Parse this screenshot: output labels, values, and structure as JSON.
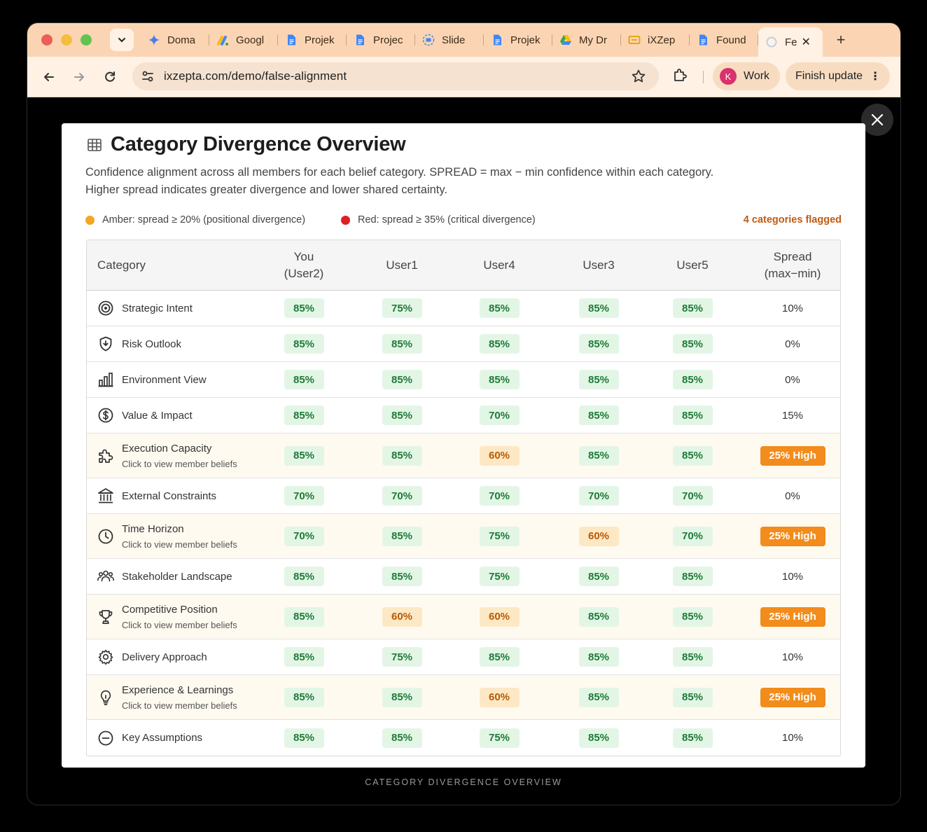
{
  "browser": {
    "tabs": [
      {
        "title": "Doma",
        "icon": "gemini-icon"
      },
      {
        "title": "Googl",
        "icon": "google-ads-icon"
      },
      {
        "title": "Projek",
        "icon": "docs-icon"
      },
      {
        "title": "Projec",
        "icon": "docs-icon"
      },
      {
        "title": "Slide",
        "icon": "slides-icon"
      },
      {
        "title": "Projek",
        "icon": "docs-icon"
      },
      {
        "title": "My Dr",
        "icon": "drive-icon"
      },
      {
        "title": "iXZep",
        "icon": "ixzepta-icon"
      },
      {
        "title": "Found",
        "icon": "docs-icon"
      },
      {
        "title": "Fe",
        "icon": "loading-icon",
        "active": true
      }
    ],
    "url": "ixzepta.com/demo/false-alignment",
    "profile_initial": "K",
    "profile_label": "Work",
    "finish_label": "Finish update"
  },
  "modal": {
    "title": "Category Divergence Overview",
    "description_line1": "Confidence alignment across all members for each belief category. SPREAD = max − min confidence within each category.",
    "description_line2": "Higher spread indicates greater divergence and lower shared certainty.",
    "legend_amber": "Amber: spread ≥ 20% (positional divergence)",
    "legend_red": "Red: spread ≥ 35% (critical divergence)",
    "flagged_count": "4 categories flagged",
    "colors": {
      "amber": "#f5a623",
      "red": "#dd1f26",
      "ok_bg": "#e3f6e6",
      "warn_bg": "#fde8c5",
      "high": "#f28c1c"
    }
  },
  "table": {
    "headers": {
      "category": "Category",
      "you_line1": "You",
      "you_line2": "(User2)",
      "user1": "User1",
      "user4": "User4",
      "user3": "User3",
      "user5": "User5",
      "spread_line1": "Spread",
      "spread_line2": "(max−min)"
    },
    "rows": [
      {
        "name": "Strategic Intent",
        "icon": "target-icon",
        "sub": "",
        "values": [
          "85%",
          "75%",
          "85%",
          "85%",
          "85%"
        ],
        "warn": [
          false,
          false,
          false,
          false,
          false
        ],
        "spread": "10%",
        "high": false
      },
      {
        "name": "Risk Outlook",
        "icon": "shield-icon",
        "sub": "",
        "values": [
          "85%",
          "85%",
          "85%",
          "85%",
          "85%"
        ],
        "warn": [
          false,
          false,
          false,
          false,
          false
        ],
        "spread": "0%",
        "high": false
      },
      {
        "name": "Environment View",
        "icon": "bar-chart-icon",
        "sub": "",
        "values": [
          "85%",
          "85%",
          "85%",
          "85%",
          "85%"
        ],
        "warn": [
          false,
          false,
          false,
          false,
          false
        ],
        "spread": "0%",
        "high": false
      },
      {
        "name": "Value & Impact",
        "icon": "dollar-icon",
        "sub": "",
        "values": [
          "85%",
          "85%",
          "70%",
          "85%",
          "85%"
        ],
        "warn": [
          false,
          false,
          false,
          false,
          false
        ],
        "spread": "15%",
        "high": false
      },
      {
        "name": "Execution Capacity",
        "icon": "puzzle-icon",
        "sub": "Click to view member beliefs",
        "values": [
          "85%",
          "85%",
          "60%",
          "85%",
          "85%"
        ],
        "warn": [
          false,
          false,
          true,
          false,
          false
        ],
        "spread": "25% High",
        "high": true
      },
      {
        "name": "External Constraints",
        "icon": "bank-icon",
        "sub": "",
        "values": [
          "70%",
          "70%",
          "70%",
          "70%",
          "70%"
        ],
        "warn": [
          false,
          false,
          false,
          false,
          false
        ],
        "spread": "0%",
        "high": false
      },
      {
        "name": "Time Horizon",
        "icon": "clock-icon",
        "sub": "Click to view member beliefs",
        "values": [
          "70%",
          "85%",
          "75%",
          "60%",
          "70%"
        ],
        "warn": [
          false,
          false,
          false,
          true,
          false
        ],
        "spread": "25% High",
        "high": true
      },
      {
        "name": "Stakeholder Landscape",
        "icon": "people-icon",
        "sub": "",
        "values": [
          "85%",
          "85%",
          "75%",
          "85%",
          "85%"
        ],
        "warn": [
          false,
          false,
          false,
          false,
          false
        ],
        "spread": "10%",
        "high": false
      },
      {
        "name": "Competitive Position",
        "icon": "trophy-icon",
        "sub": "Click to view member beliefs",
        "values": [
          "85%",
          "60%",
          "60%",
          "85%",
          "85%"
        ],
        "warn": [
          false,
          true,
          true,
          false,
          false
        ],
        "spread": "25% High",
        "high": true
      },
      {
        "name": "Delivery Approach",
        "icon": "gear-icon",
        "sub": "",
        "values": [
          "85%",
          "75%",
          "85%",
          "85%",
          "85%"
        ],
        "warn": [
          false,
          false,
          false,
          false,
          false
        ],
        "spread": "10%",
        "high": false
      },
      {
        "name": "Experience & Learnings",
        "icon": "lightbulb-icon",
        "sub": "Click to view member beliefs",
        "values": [
          "85%",
          "85%",
          "60%",
          "85%",
          "85%"
        ],
        "warn": [
          false,
          false,
          true,
          false,
          false
        ],
        "spread": "25% High",
        "high": true
      },
      {
        "name": "Key Assumptions",
        "icon": "minus-circle-icon",
        "sub": "",
        "values": [
          "85%",
          "85%",
          "75%",
          "85%",
          "85%"
        ],
        "warn": [
          false,
          false,
          false,
          false,
          false
        ],
        "spread": "10%",
        "high": false
      }
    ]
  },
  "caption": "CATEGORY DIVERGENCE OVERVIEW"
}
